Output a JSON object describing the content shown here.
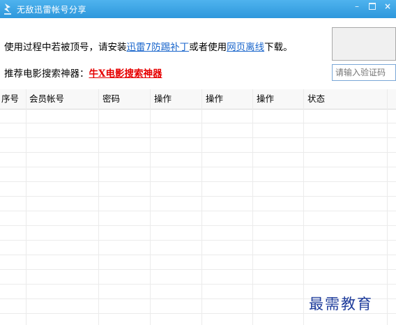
{
  "window": {
    "title": "无敌迅雷帐号分享",
    "icon": "thunder-bird-icon",
    "controls": {
      "minimize": "–",
      "close": "×"
    },
    "title_color": "#2d97dc"
  },
  "notice": {
    "text_before": "使用过程中若被顶号，请安装",
    "link1": "迅雷7防踢补丁",
    "text_middle": "或者使用",
    "link2": "网页离线",
    "text_after": "下载。"
  },
  "recommend": {
    "label": "推荐电影搜索神器：",
    "link": "牛X电影搜索神器"
  },
  "captcha": {
    "placeholder": "请输入验证码"
  },
  "table": {
    "columns": [
      "序号",
      "会员帐号",
      "密码",
      "操作",
      "操作",
      "操作",
      "状态"
    ],
    "rows": []
  },
  "watermark": "最需教育",
  "colors": {
    "link": "#1a66cc",
    "highlight": "#e60000"
  }
}
